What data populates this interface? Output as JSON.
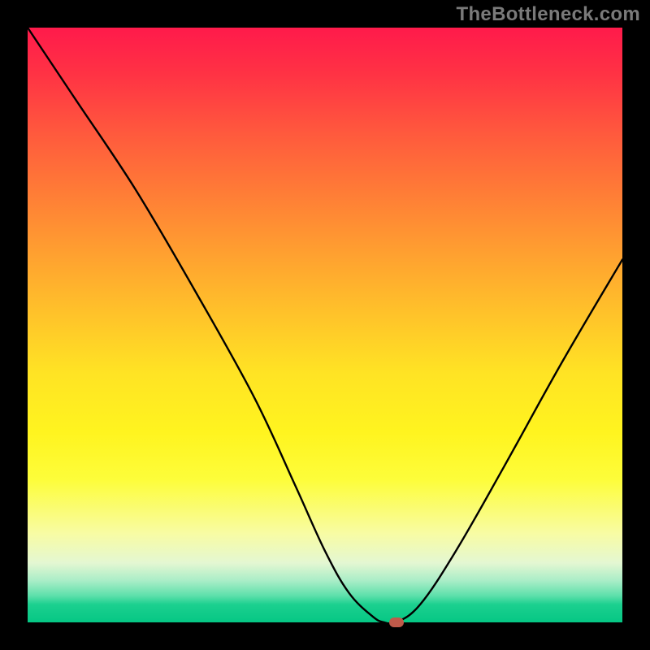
{
  "watermark": "TheBottleneck.com",
  "chart_data": {
    "type": "line",
    "title": "",
    "xlabel": "",
    "ylabel": "",
    "xlim": [
      0,
      100
    ],
    "ylim": [
      0,
      100
    ],
    "x": [
      0,
      8,
      18,
      28,
      38,
      45,
      50,
      54,
      58,
      60,
      62,
      66,
      72,
      80,
      90,
      100
    ],
    "y": [
      100,
      88,
      73,
      56,
      38,
      23,
      12,
      5,
      1,
      0,
      0,
      3,
      12,
      26,
      44,
      61
    ],
    "marker": {
      "x": 62,
      "y": 0
    },
    "gradient_stops": [
      {
        "pos": 0,
        "color": "#ff1a4b"
      },
      {
        "pos": 50,
        "color": "#ffe324"
      },
      {
        "pos": 90,
        "color": "#e4f7d2"
      },
      {
        "pos": 100,
        "color": "#05c784"
      }
    ]
  }
}
